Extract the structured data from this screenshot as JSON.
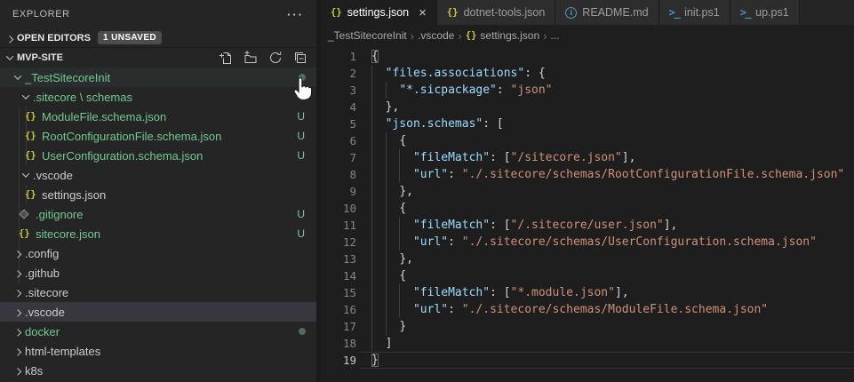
{
  "sidebar": {
    "title": "EXPLORER",
    "more_actions": "···",
    "open_editors": {
      "label": "OPEN EDITORS",
      "badge": "1 UNSAVED"
    },
    "section": {
      "label": "MVP-SITE",
      "actions": [
        {
          "name": "new-file-icon"
        },
        {
          "name": "new-folder-icon"
        },
        {
          "name": "refresh-icon"
        },
        {
          "name": "collapse-all-icon"
        }
      ]
    },
    "tree": [
      {
        "label": "_TestSitecoreInit",
        "kind": "folder",
        "expanded": true,
        "level": 1,
        "color": "green",
        "badge": "dot",
        "state": "hover"
      },
      {
        "label": ".sitecore \\ schemas",
        "kind": "folder",
        "expanded": true,
        "level": 2,
        "color": "green",
        "badge": "dot"
      },
      {
        "label": "ModuleFile.schema.json",
        "kind": "file",
        "icon": "braces",
        "level": 3,
        "color": "green",
        "badge": "U"
      },
      {
        "label": "RootConfigurationFile.schema.json",
        "kind": "file",
        "icon": "braces",
        "level": 3,
        "color": "green",
        "badge": "U"
      },
      {
        "label": "UserConfiguration.schema.json",
        "kind": "file",
        "icon": "braces",
        "level": 3,
        "color": "green",
        "badge": "U"
      },
      {
        "label": ".vscode",
        "kind": "folder",
        "expanded": true,
        "level": 2,
        "color": "default"
      },
      {
        "label": "settings.json",
        "kind": "file",
        "icon": "braces",
        "level": 3,
        "color": "default"
      },
      {
        "label": ".gitignore",
        "kind": "file",
        "icon": "git",
        "level": 2,
        "color": "green",
        "badge": "U"
      },
      {
        "label": "sitecore.json",
        "kind": "file",
        "icon": "braces",
        "level": 2,
        "color": "green",
        "badge": "U"
      },
      {
        "label": ".config",
        "kind": "folder",
        "expanded": false,
        "level": 1,
        "color": "default"
      },
      {
        "label": ".github",
        "kind": "folder",
        "expanded": false,
        "level": 1,
        "color": "default"
      },
      {
        "label": ".sitecore",
        "kind": "folder",
        "expanded": false,
        "level": 1,
        "color": "default"
      },
      {
        "label": ".vscode",
        "kind": "folder",
        "expanded": false,
        "level": 1,
        "color": "default",
        "state": "selected"
      },
      {
        "label": "docker",
        "kind": "folder",
        "expanded": false,
        "level": 1,
        "color": "green",
        "badge": "dot"
      },
      {
        "label": "html-templates",
        "kind": "folder",
        "expanded": false,
        "level": 1,
        "color": "default"
      },
      {
        "label": "k8s",
        "kind": "folder",
        "expanded": false,
        "level": 1,
        "color": "default"
      }
    ]
  },
  "editor": {
    "tabs": [
      {
        "label": "settings.json",
        "icon": "braces",
        "active": true,
        "close": "×"
      },
      {
        "label": "dotnet-tools.json",
        "icon": "braces"
      },
      {
        "label": "README.md",
        "icon": "info"
      },
      {
        "label": "init.ps1",
        "icon": "ps"
      },
      {
        "label": "up.ps1",
        "icon": "ps"
      }
    ],
    "breadcrumb": [
      {
        "label": "_TestSitecoreInit"
      },
      {
        "label": ".vscode"
      },
      {
        "label": "settings.json",
        "icon": "braces"
      },
      {
        "label": "..."
      }
    ],
    "code": {
      "current_line": 19,
      "lines": [
        [
          [
            "{",
            "p bm"
          ]
        ],
        [
          [
            "  ",
            "w"
          ],
          [
            "\"files.associations\"",
            "k"
          ],
          [
            ": ",
            "p"
          ],
          [
            "{",
            "p"
          ]
        ],
        [
          [
            "    ",
            "w"
          ],
          [
            "\"*.sicpackage\"",
            "k"
          ],
          [
            ": ",
            "p"
          ],
          [
            "\"json\"",
            "s"
          ]
        ],
        [
          [
            "  ",
            "w"
          ],
          [
            "},",
            "p"
          ]
        ],
        [
          [
            "  ",
            "w"
          ],
          [
            "\"json.schemas\"",
            "k"
          ],
          [
            ": ",
            "p"
          ],
          [
            "[",
            "p"
          ]
        ],
        [
          [
            "    ",
            "w"
          ],
          [
            "{",
            "p"
          ]
        ],
        [
          [
            "      ",
            "w"
          ],
          [
            "\"fileMatch\"",
            "k"
          ],
          [
            ": ",
            "p"
          ],
          [
            "[",
            "p"
          ],
          [
            "\"/sitecore.json\"",
            "s"
          ],
          [
            "],",
            "p"
          ]
        ],
        [
          [
            "      ",
            "w"
          ],
          [
            "\"url\"",
            "k"
          ],
          [
            ": ",
            "p"
          ],
          [
            "\"./.sitecore/schemas/RootConfigurationFile.schema.json\"",
            "s"
          ]
        ],
        [
          [
            "    ",
            "w"
          ],
          [
            "},",
            "p"
          ]
        ],
        [
          [
            "    ",
            "w"
          ],
          [
            "{",
            "p"
          ]
        ],
        [
          [
            "      ",
            "w"
          ],
          [
            "\"fileMatch\"",
            "k"
          ],
          [
            ": ",
            "p"
          ],
          [
            "[",
            "p"
          ],
          [
            "\"/.sitecore/user.json\"",
            "s"
          ],
          [
            "],",
            "p"
          ]
        ],
        [
          [
            "      ",
            "w"
          ],
          [
            "\"url\"",
            "k"
          ],
          [
            ": ",
            "p"
          ],
          [
            "\"./.sitecore/schemas/UserConfiguration.schema.json\"",
            "s"
          ]
        ],
        [
          [
            "    ",
            "w"
          ],
          [
            "},",
            "p"
          ]
        ],
        [
          [
            "    ",
            "w"
          ],
          [
            "{",
            "p"
          ]
        ],
        [
          [
            "      ",
            "w"
          ],
          [
            "\"fileMatch\"",
            "k"
          ],
          [
            ": ",
            "p"
          ],
          [
            "[",
            "p"
          ],
          [
            "\"*.module.json\"",
            "s"
          ],
          [
            "],",
            "p"
          ]
        ],
        [
          [
            "      ",
            "w"
          ],
          [
            "\"url\"",
            "k"
          ],
          [
            ": ",
            "p"
          ],
          [
            "\"./.sitecore/schemas/ModuleFile.schema.json\"",
            "s"
          ]
        ],
        [
          [
            "    ",
            "w"
          ],
          [
            "}",
            "p"
          ]
        ],
        [
          [
            "  ",
            "w"
          ],
          [
            "]",
            "p"
          ]
        ],
        [
          [
            "}",
            "p bm"
          ]
        ]
      ]
    }
  },
  "colors": {
    "untracked_green": "#73c991",
    "json_icon_yellow": "#cbcb41",
    "key_blue": "#9cdcfe",
    "string_orange": "#ce9178",
    "sidebar_bg": "#252526",
    "editor_bg": "#1e1e1e",
    "selected_row": "#37373d"
  }
}
